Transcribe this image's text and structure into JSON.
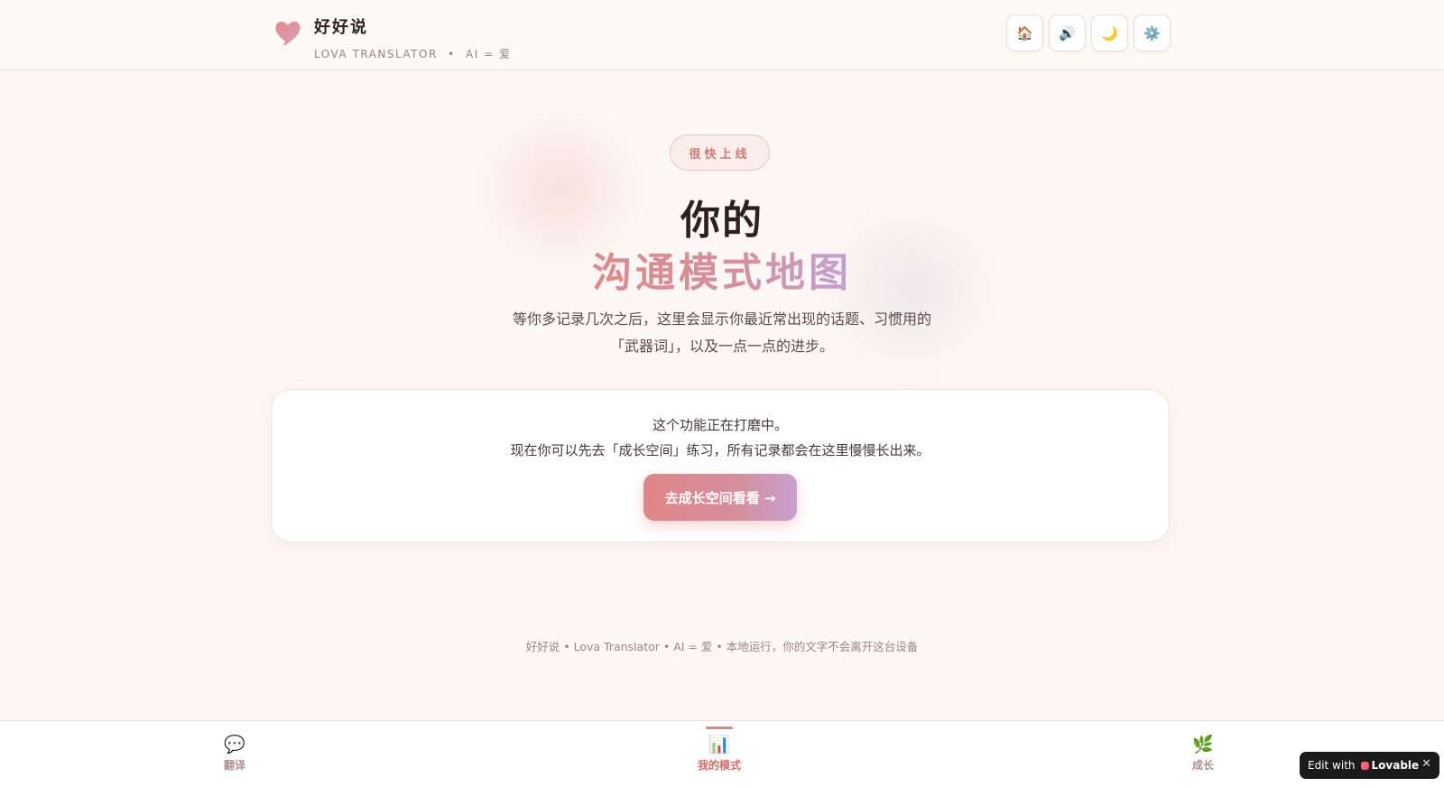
{
  "app": {
    "title": "好好说",
    "subtitle_left": "LOVA TRANSLATOR",
    "subtitle_sep": "•",
    "subtitle_right": "AI = 爱"
  },
  "toolbar": {
    "buttons": [
      {
        "icon": "home-icon",
        "glyph": "🏠"
      },
      {
        "icon": "speaker-icon",
        "glyph": "🔊"
      },
      {
        "icon": "moon-icon",
        "glyph": "🌙"
      },
      {
        "icon": "gear-icon",
        "glyph": "⚙️"
      }
    ]
  },
  "hero": {
    "badge": "很快上线",
    "title_line1": "你的",
    "title_line2": "沟通模式地图",
    "desc_line1": "等你多记录几次之后，这里会显示你最近常出现的话题、习惯用的",
    "desc_line2": "「武器词」，以及一点一点的进步。"
  },
  "card": {
    "line1": "这个功能正在打磨中。",
    "line2": "现在你可以先去「成长空间」练习，所有记录都会在这里慢慢长出来。",
    "cta_label": "去成长空间看看 →"
  },
  "footer": {
    "note": "好好说 • Lova Translator • AI = 爱 • 本地运行，你的文字不会离开这台设备"
  },
  "bottom_nav": {
    "items": [
      {
        "icon": "speech-bubble-icon",
        "glyph": "💬",
        "label": "翻译"
      },
      {
        "icon": "bar-chart-icon",
        "glyph": "📊",
        "label": "我的模式",
        "active": true
      },
      {
        "icon": "sprout-icon",
        "glyph": "🌿",
        "label": "成长"
      }
    ]
  },
  "lovable_badge": {
    "prefix": "Edit with",
    "brand": "Lovable",
    "close": "✕"
  },
  "colors": {
    "accent": "#e0857f",
    "background": "#fdf8f5",
    "gradient_start": "#e08a86",
    "gradient_end": "#c4a1d1"
  }
}
